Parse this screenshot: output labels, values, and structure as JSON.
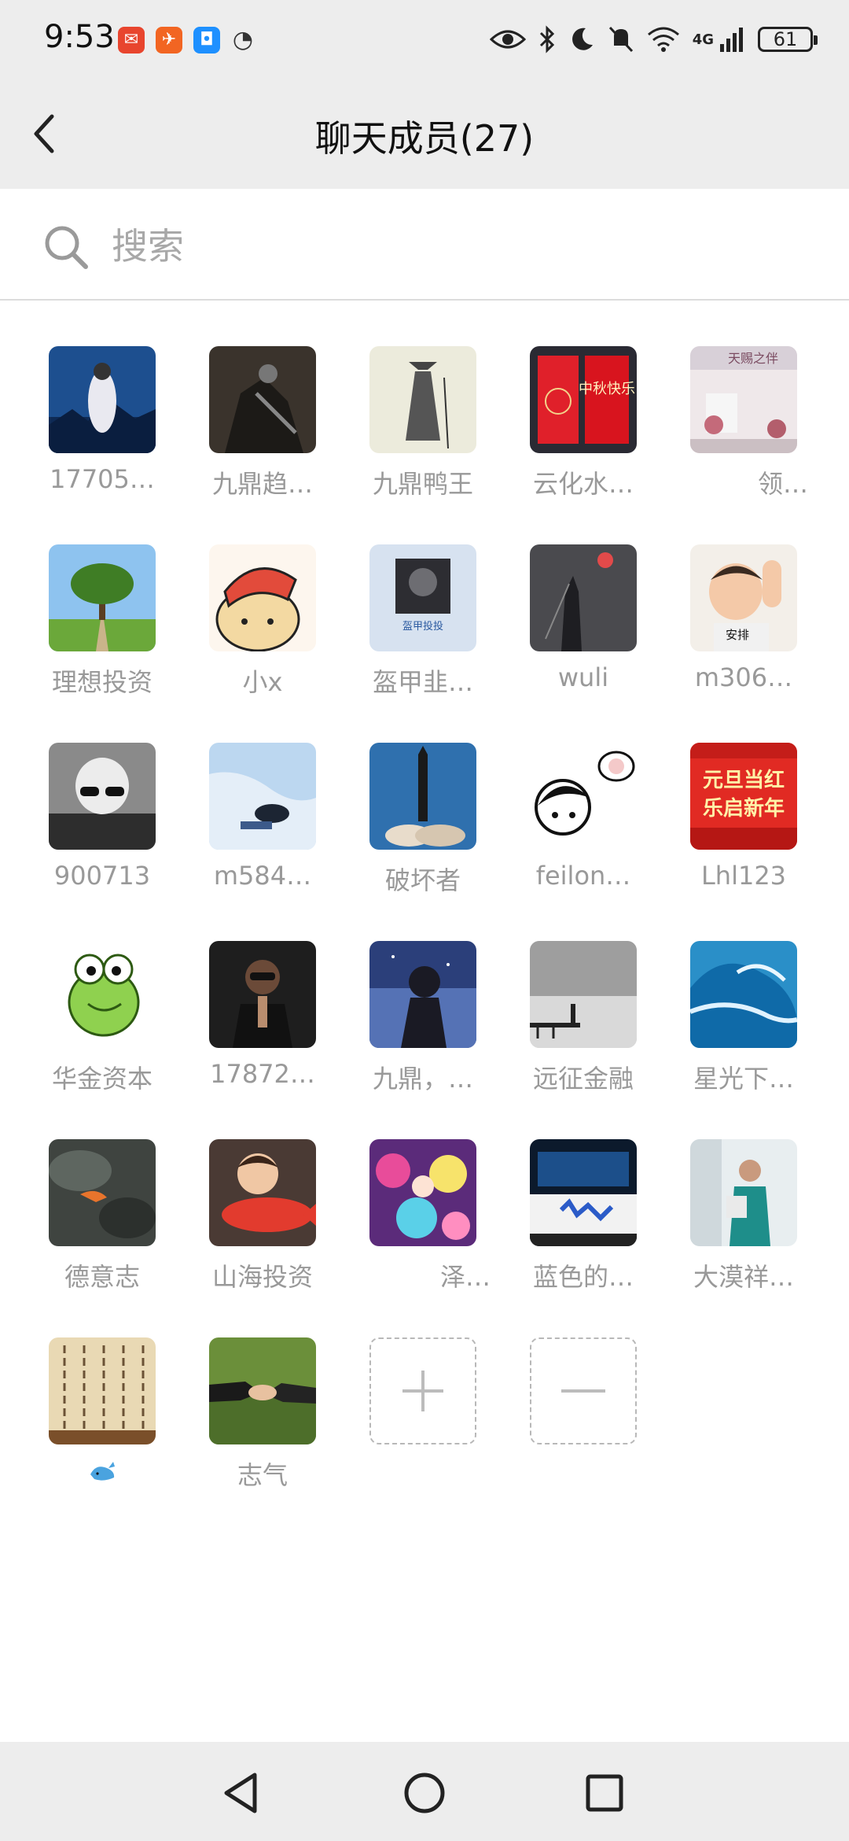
{
  "status_bar": {
    "time": "9:53",
    "network": "4G",
    "battery": "61"
  },
  "header": {
    "title": "聊天成员(27)"
  },
  "search": {
    "placeholder": "搜索"
  },
  "members": [
    {
      "name": "17705…"
    },
    {
      "name": "九鼎趋…"
    },
    {
      "name": "九鼎鸭王"
    },
    {
      "name": "云化水…"
    },
    {
      "name": "领…"
    },
    {
      "name": "理想投资"
    },
    {
      "name": "小x"
    },
    {
      "name": "盔甲韭…"
    },
    {
      "name": "wuli"
    },
    {
      "name": "m306…"
    },
    {
      "name": "900713"
    },
    {
      "name": "m584…"
    },
    {
      "name": "破坏者"
    },
    {
      "name": "feilon…"
    },
    {
      "name": "Lhl123"
    },
    {
      "name": "华金资本"
    },
    {
      "name": "17872…"
    },
    {
      "name": "九鼎，…"
    },
    {
      "name": "远征金融"
    },
    {
      "name": "星光下…"
    },
    {
      "name": "德意志"
    },
    {
      "name": "山海投资"
    },
    {
      "name": "泽…"
    },
    {
      "name": "蓝色的…"
    },
    {
      "name": "大漠祥…"
    },
    {
      "name": ""
    },
    {
      "name": "志气"
    }
  ],
  "avatar_texts": {
    "yunhua": "中秋快乐",
    "ling": "天赐之伴",
    "kuijia": "盔甲投投",
    "m306": "安排",
    "lhl": "元旦当红",
    "lhl2": "乐启新年"
  },
  "actions": {
    "add": "+",
    "remove": "−"
  }
}
